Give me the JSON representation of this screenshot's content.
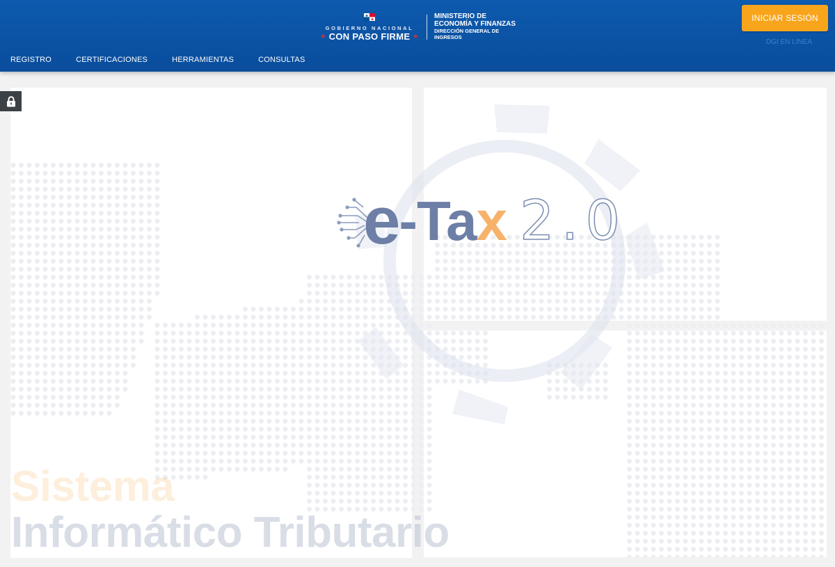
{
  "header": {
    "gov_line1": "GOBIERNO NACIONAL",
    "gov_line2": "CON PASO FIRME",
    "ministry_line1": "MINISTERIO DE",
    "ministry_line2": "ECONOMÍA Y FINANZAS",
    "ministry_line3": "DIRECCIÓN  GENERAL DE",
    "ministry_line4": "INGRESOS",
    "login_button": "INICIAR SESIÓN",
    "dgi_link": "DGI EN LINEA"
  },
  "nav": [
    {
      "label": "REGISTRO"
    },
    {
      "label": "CERTIFICACIONES"
    },
    {
      "label": "HERRAMIENTAS"
    },
    {
      "label": "CONSULTAS"
    }
  ],
  "hero": {
    "logo_e": "e",
    "logo_dash_t": "-Ta",
    "logo_x": "x",
    "logo_version": "2.0",
    "sistema": "Sistema",
    "informatico": "Informático Tributario"
  },
  "icons": {
    "lock": "lock-icon",
    "flag": "panama-flag-icon"
  },
  "colors": {
    "header_blue": "#0b51a2",
    "accent_orange": "#f8a51c",
    "logo_slate": "#6d7fa6",
    "logo_orange": "#f6b26b"
  }
}
